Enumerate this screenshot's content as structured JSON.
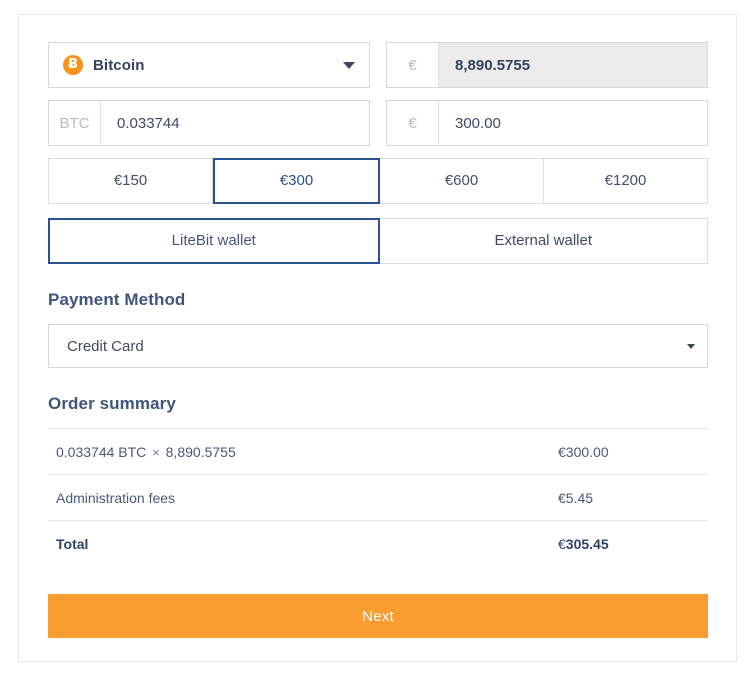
{
  "currency_selector": {
    "icon": "bitcoin-coin-icon",
    "glyph": "Ƀ",
    "name": "Bitcoin",
    "caret": "chevron-down-icon"
  },
  "rate_field": {
    "prefix": "€",
    "value": "8,890.5755",
    "readonly": true
  },
  "crypto_amount_field": {
    "prefix": "BTC",
    "value": "0.033744",
    "placeholder": "0.00000000"
  },
  "fiat_amount_field": {
    "prefix": "€",
    "value": "300.00",
    "placeholder": "0.00"
  },
  "presets": [
    {
      "label": "€150",
      "selected": false
    },
    {
      "label": "€300",
      "selected": true
    },
    {
      "label": "€600",
      "selected": false
    },
    {
      "label": "€1200",
      "selected": false
    }
  ],
  "wallets": [
    {
      "label": "LiteBit wallet",
      "selected": true
    },
    {
      "label": "External wallet",
      "selected": false
    }
  ],
  "payment": {
    "heading": "Payment Method",
    "selected": "Credit Card",
    "options": [
      "Credit Card"
    ],
    "caret": "chevron-down-icon"
  },
  "order_summary": {
    "heading": "Order summary",
    "rows": [
      {
        "label_amount": "0.033744 BTC",
        "label_mult": "×",
        "label_rate": "8,890.5755",
        "value": "€300.00"
      },
      {
        "label": "Administration fees",
        "value": "€5.45"
      }
    ],
    "total": {
      "label": "Total",
      "value_symbol": "€",
      "value_number": "305.45"
    }
  },
  "next_button": {
    "label": "Next",
    "color": "#f99d30"
  }
}
